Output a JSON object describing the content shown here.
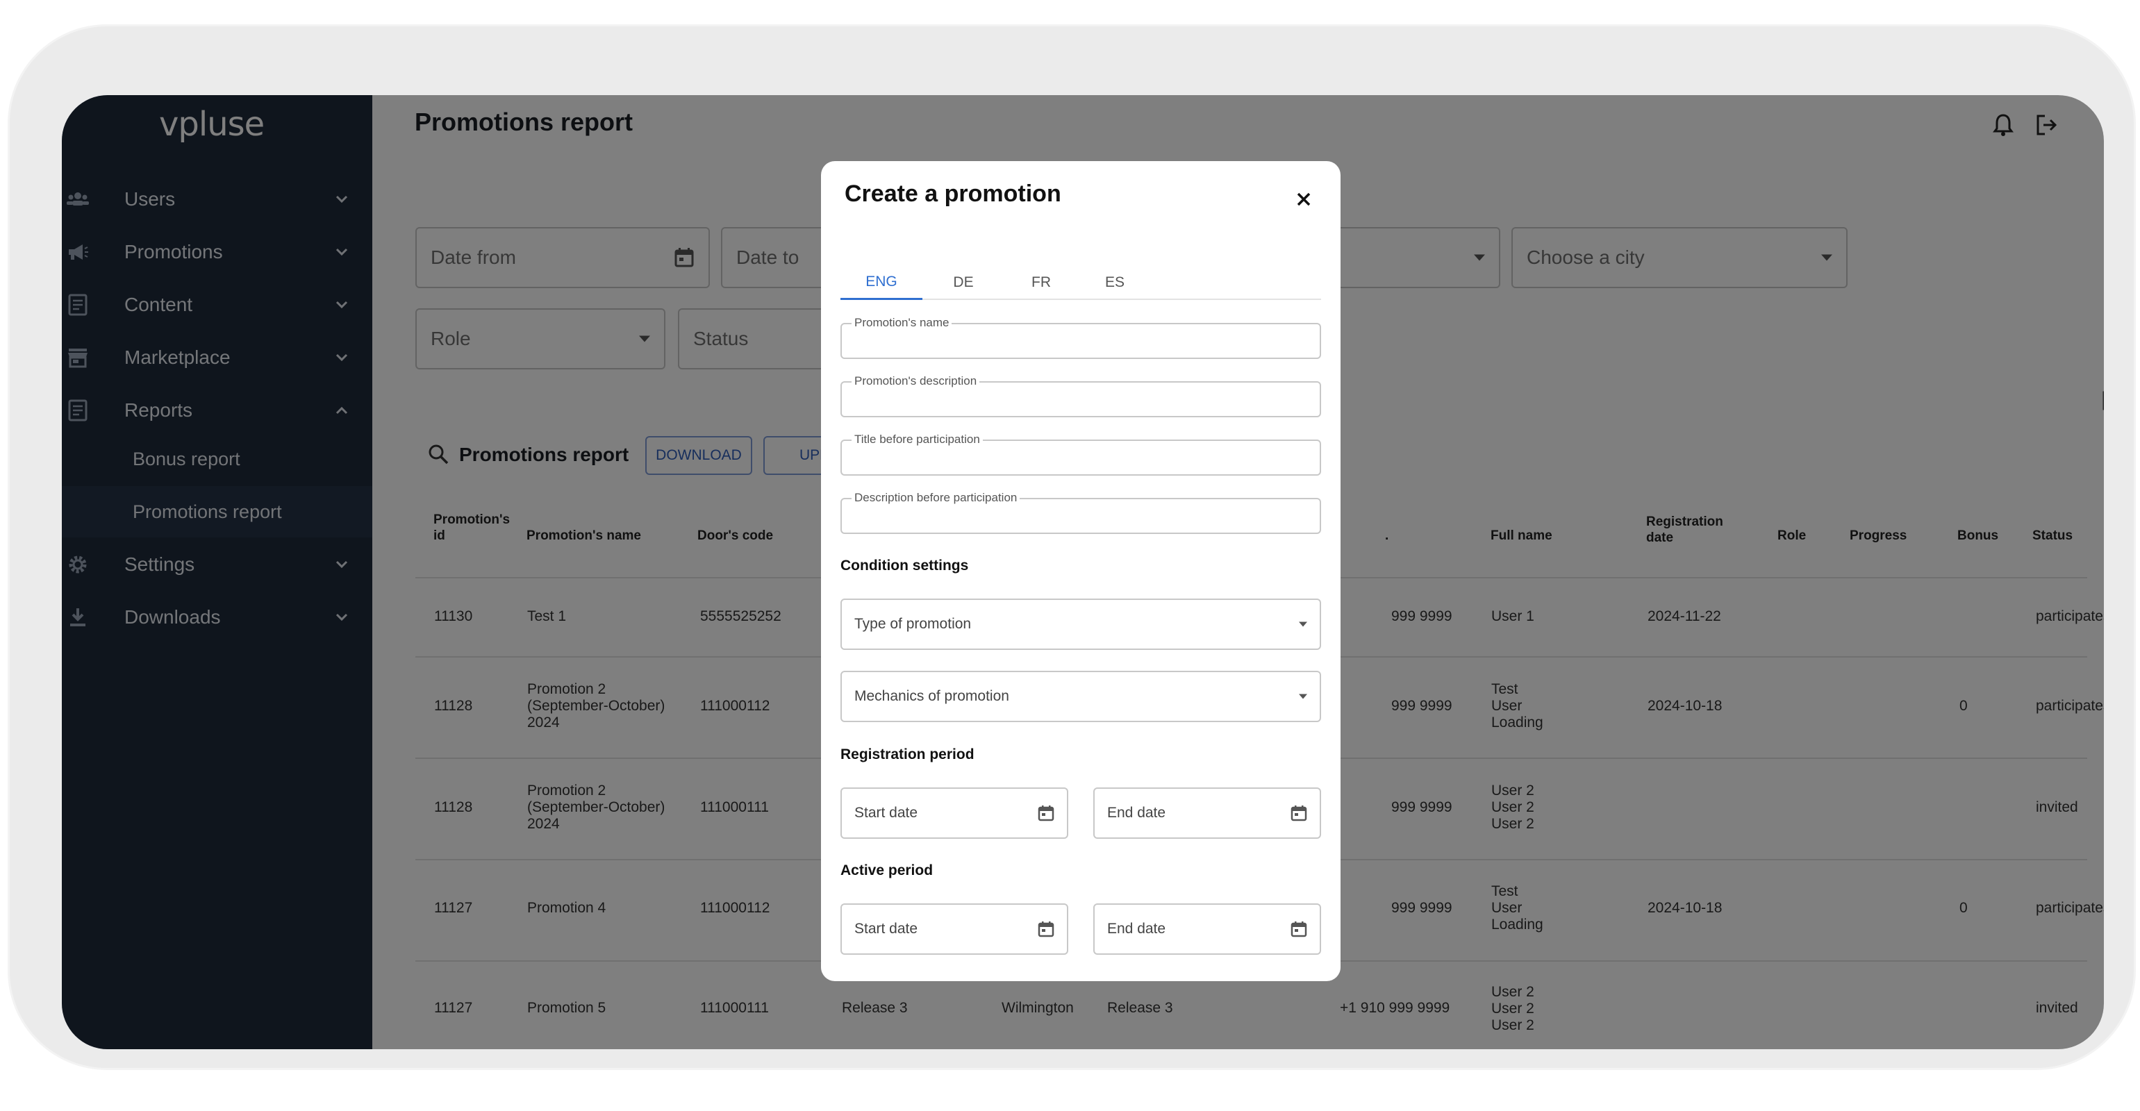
{
  "app": {
    "logo": "vpluse",
    "page_title": "Promotions report"
  },
  "sidebar": {
    "items": [
      {
        "label": "Users",
        "icon": "users-icon"
      },
      {
        "label": "Promotions",
        "icon": "megaphone-icon"
      },
      {
        "label": "Content",
        "icon": "document-icon"
      },
      {
        "label": "Marketplace",
        "icon": "store-icon"
      },
      {
        "label": "Reports",
        "icon": "report-icon"
      },
      {
        "label": "Settings",
        "icon": "gear-icon"
      },
      {
        "label": "Downloads",
        "icon": "download-icon"
      }
    ],
    "reports_sub": [
      {
        "label": "Bonus report"
      },
      {
        "label": "Promotions report"
      }
    ]
  },
  "filters": {
    "date_from": "Date from",
    "date_to": "Date to",
    "choose_city": "Choose a city",
    "role": "Role",
    "status": "Status"
  },
  "report": {
    "title": "Promotions report",
    "download_label": "DOWNLOAD",
    "upload_label": "UPL"
  },
  "table": {
    "headers": {
      "id": "Promotion's id",
      "name": "Promotion's name",
      "door": "Door's code",
      "phone": ".",
      "full_name": "Full name",
      "reg_date": "Registration date",
      "role": "Role",
      "progress": "Progress",
      "bonus": "Bonus",
      "status": "Status"
    },
    "rows": [
      {
        "id": "11130",
        "name": "Test 1",
        "door": "5555525252",
        "col4": "",
        "col5": "",
        "col6": "",
        "phone": "999 9999",
        "full_name": "User 1",
        "reg_date": "2024-11-22",
        "bonus": "",
        "status": "participates"
      },
      {
        "id": "11128",
        "name": "Promotion 2 (September-October) 2024",
        "door": "111000112",
        "col4": "",
        "col5": "",
        "col6": "",
        "phone": "999 9999",
        "full_name": "Test User Loading",
        "reg_date": "2024-10-18",
        "bonus": "0",
        "status": "participates"
      },
      {
        "id": "11128",
        "name": "Promotion 2 (September-October) 2024",
        "door": "111000111",
        "col4": "",
        "col5": "",
        "col6": "",
        "phone": "999 9999",
        "full_name": "User 2 User 2 User 2",
        "reg_date": "",
        "bonus": "",
        "status": "invited"
      },
      {
        "id": "11127",
        "name": "Promotion 4",
        "door": "111000112",
        "col4": "",
        "col5": "",
        "col6": "",
        "phone": "999 9999",
        "full_name": "Test User Loading",
        "reg_date": "2024-10-18",
        "bonus": "0",
        "status": "participates"
      },
      {
        "id": "11127",
        "name": "Promotion 5",
        "door": "111000111",
        "col4": "Release 3",
        "col5": "Wilmington",
        "col6": "Release 3",
        "phone": "+1 910 999 9999",
        "full_name": "User 2 User 2 User 2",
        "reg_date": "",
        "bonus": "",
        "status": "invited"
      }
    ]
  },
  "modal": {
    "title": "Create a promotion",
    "tabs": [
      "ENG",
      "DE",
      "FR",
      "ES"
    ],
    "active_tab": "ENG",
    "fields": {
      "name": "Promotion's name",
      "description": "Promotion's description",
      "title_before": "Title before participation",
      "description_before": "Description before participation"
    },
    "condition_settings": "Condition settings",
    "type_of_promotion": "Type of promotion",
    "mechanics_of_promotion": "Mechanics of promotion",
    "registration_period": "Registration period",
    "active_period": "Active period",
    "start_date": "Start date",
    "end_date": "End date"
  },
  "colors": {
    "sidebar_bg": "#1e2a3b",
    "accent": "#2f6fd0",
    "overlay": "rgba(0,0,0,0.5)"
  }
}
